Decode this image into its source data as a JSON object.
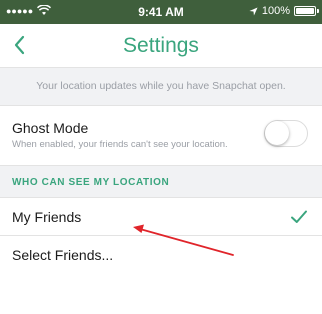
{
  "status_bar": {
    "carrier_dots": "●●●●●",
    "time": "9:41 AM",
    "battery": "100%"
  },
  "nav": {
    "back_label": "Back",
    "title": "Settings"
  },
  "info": "Your location updates while you have Snapchat open.",
  "ghost_mode": {
    "title": "Ghost Mode",
    "subtitle": "When enabled, your friends can't see your location.",
    "enabled": false
  },
  "section_header": "WHO CAN SEE MY LOCATION",
  "options": [
    {
      "label": "My Friends",
      "selected": true
    },
    {
      "label": "Select Friends...",
      "selected": false
    }
  ],
  "colors": {
    "accent": "#3aa57e",
    "status_bar": "#3f5f3c",
    "annotation_arrow": "#e0242a"
  }
}
